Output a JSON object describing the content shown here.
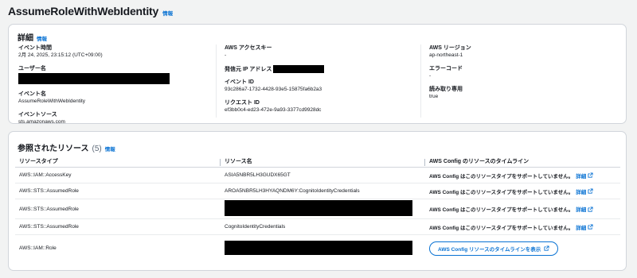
{
  "page": {
    "title": "AssumeRoleWithWebIdentity",
    "info_label": "情報"
  },
  "details": {
    "title": "詳細",
    "info_label": "情報",
    "fields": {
      "event_time_label": "イベント時間",
      "event_time_value": "2月 24, 2025, 23:15:12 (UTC+09:00)",
      "user_name_label": "ユーザー名",
      "event_name_label": "イベント名",
      "event_name_value": "AssumeRoleWithWebIdentity",
      "event_source_label": "イベントソース",
      "event_source_value": "sts.amazonaws.com",
      "access_key_label": "AWS アクセスキー",
      "access_key_value": "-",
      "source_ip_label": "発信元 IP アドレス",
      "event_id_label": "イベント ID",
      "event_id_value": "93c286a7-1732-4428-93e5-15875fa6b2a3",
      "request_id_label": "リクエスト ID",
      "request_id_value": "ef3bb0c4-ed23-472e-9a93-3377cd9928dc",
      "region_label": "AWS リージョン",
      "region_value": "ap-northeast-1",
      "error_code_label": "エラーコード",
      "error_code_value": "-",
      "read_only_label": "読み取り専用",
      "read_only_value": "true"
    }
  },
  "resources": {
    "title": "参照されたリソース",
    "count": "(5)",
    "info_label": "情報",
    "columns": [
      "リソースタイプ",
      "リソース名",
      "AWS Config のリソースのタイムライン"
    ],
    "config_unsupported": "AWS Config はこのリソースタイプをサポートしていません。",
    "detail_link": "詳細",
    "timeline_button": "AWS Config リソースのタイムラインを表示",
    "rows": [
      {
        "type": "AWS::IAM::AccessKey",
        "name": "ASIA5NBR5LH3GUDX65GT"
      },
      {
        "type": "AWS::STS::AssumedRole",
        "name": "AROA5NBR5LH3HYAQNDM6Y:CognitoIdentityCredentials"
      },
      {
        "type": "AWS::STS::AssumedRole",
        "name": ""
      },
      {
        "type": "AWS::STS::AssumedRole",
        "name": "CognitoIdentityCredentials"
      },
      {
        "type": "AWS::IAM::Role",
        "name": ""
      }
    ]
  },
  "icons": {
    "external": "external-link-icon"
  },
  "colors": {
    "link": "#0972d3",
    "border": "#d1d5db",
    "background": "#f2f3f3"
  }
}
